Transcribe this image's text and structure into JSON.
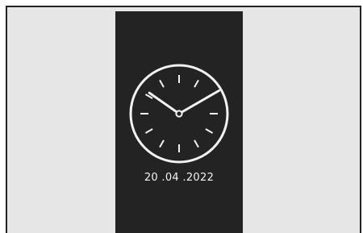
{
  "clock": {
    "hour": 10,
    "minute": 10
  },
  "date_text": "20 .04 .2022",
  "colors": {
    "page_background": "#ffffff",
    "frame_background": "#e6e6e7",
    "screen_background": "#232323",
    "foreground": "#f2f2f2"
  }
}
